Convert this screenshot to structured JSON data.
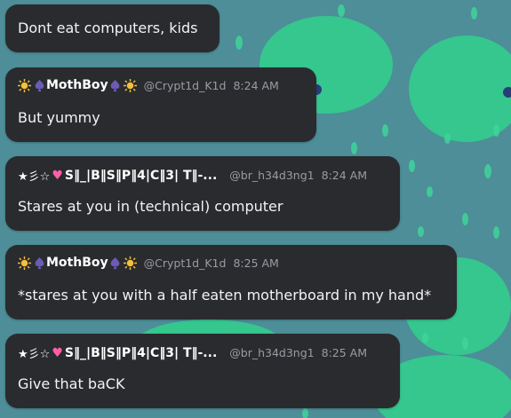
{
  "messages": [
    {
      "text": "Dont eat computers, kids"
    },
    {
      "name": "MothBoy",
      "handle": "@Crypt1d_K1d",
      "time": "8:24 AM",
      "text": "But yummy"
    },
    {
      "name": "S‖_|B‖S‖P‖4|C‖3| T‖-...",
      "prefix": "★彡☆",
      "handle": "@br_h34d3ng1",
      "time": "8:24 AM",
      "text": "Stares at you in (technical) computer"
    },
    {
      "name": "MothBoy",
      "handle": "@Crypt1d_K1d",
      "time": "8:25 AM",
      "text": "*stares at you with a half eaten motherboard in my hand*"
    },
    {
      "name": "S‖_|B‖S‖P‖4|C‖3| T‖-...",
      "prefix": "★彡☆",
      "handle": "@br_h34d3ng1",
      "time": "8:25 AM",
      "text": "Give that baCK"
    }
  ],
  "icons": {
    "sun": "sun-icon",
    "spade": "spade-icon",
    "heart": "heart-icon"
  },
  "colors": {
    "bubble": "#2a2b2e",
    "background": "#4d8e98",
    "accent_green": "#3fd39a",
    "spade_purple": "#6b5bb5",
    "sun_yellow": "#f5c03a",
    "heart_pink": "#ff5fa8"
  }
}
